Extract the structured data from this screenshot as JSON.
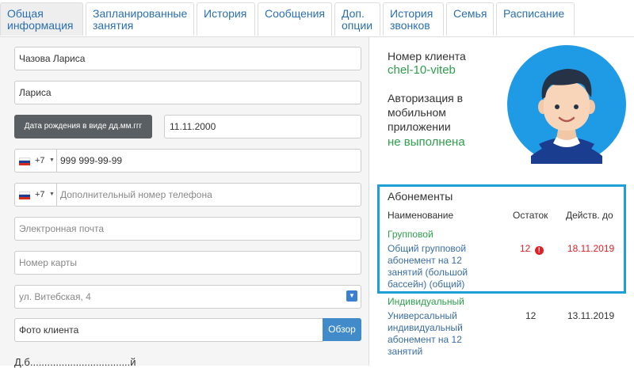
{
  "tabs": [
    {
      "label": "Общая\nинформация",
      "active": true
    },
    {
      "label": "Запланированные\nзанятия"
    },
    {
      "label": "История"
    },
    {
      "label": "Сообщения"
    },
    {
      "label": "Доп.\nопции"
    },
    {
      "label": "История\nзвонков"
    },
    {
      "label": "Семья"
    },
    {
      "label": "Расписание"
    }
  ],
  "form": {
    "full_name": "Чазова Лариса",
    "first_name": "Лариса",
    "dob_button": "Дата рождения в виде дд.мм.ггг",
    "dob_value": "11.11.2000",
    "phone_code": "+7",
    "phone_value": "999 999-99-99",
    "phone2_code": "+7",
    "phone2_placeholder": "Дополнительный номер телефона",
    "email_placeholder": "Электронная почта",
    "card_placeholder": "Номер карты",
    "address_placeholder": "ул. Витебская, 4",
    "photo_placeholder": "Фото клиента",
    "browse_label": "Обзор",
    "bottom_cut_text": "Д.б...................................й"
  },
  "client": {
    "number_label": "Номер клиента",
    "number_value": "chel-10-viteb",
    "auth_label": "Авторизация в\nмобильном\nприложении",
    "auth_value": "не выполнена"
  },
  "subscriptions": {
    "title": "Абонементы",
    "headers": {
      "name": "Наименование",
      "rest": "Остаток",
      "valid": "Действ. до"
    },
    "groups": [
      {
        "group": "Групповой",
        "name": "Общий групповой\nабонемент на 12\nзанятий (большой\nбассейн) (общий)",
        "rest": "12",
        "warning": "!",
        "valid": "18.11.2019"
      },
      {
        "group": "Индивидуальный",
        "name": "Универсальный\nиндивидуальный\nабонемент на 12\nзанятий",
        "rest": "12",
        "valid": "13.11.2019"
      }
    ]
  },
  "colors": {
    "accent": "#1f9ed8",
    "link": "#3a6ea5",
    "success": "#2e9f4c",
    "danger": "#e31e24"
  }
}
